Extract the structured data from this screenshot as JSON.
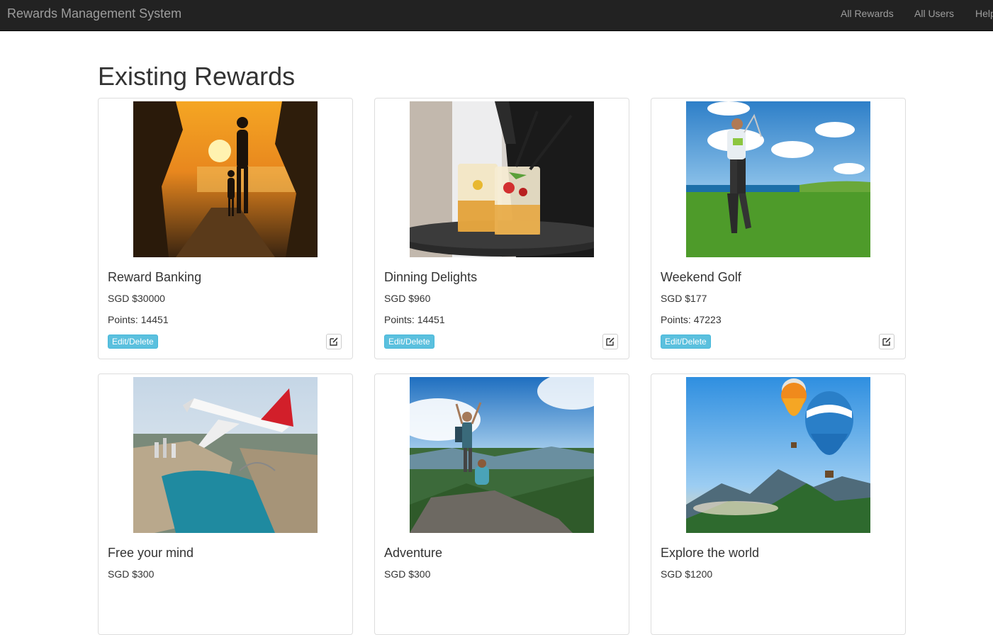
{
  "navbar": {
    "brand": "Rewards Management System",
    "links": [
      "All Rewards",
      "All Users",
      "Help"
    ]
  },
  "page": {
    "title": "Existing Rewards"
  },
  "rewards": [
    {
      "name": "Reward Banking",
      "price": "SGD $30000",
      "points": "Points: 14451",
      "edit_label": "Edit/Delete",
      "image": "sunset-family-photo",
      "show_actions": true
    },
    {
      "name": "Dinning Delights",
      "price": "SGD $960",
      "points": "Points: 14451",
      "edit_label": "Edit/Delete",
      "image": "cocktail-tray-photo",
      "show_actions": true
    },
    {
      "name": "Weekend Golf",
      "price": "SGD $177",
      "points": "Points: 47223",
      "edit_label": "Edit/Delete",
      "image": "golfer-photo",
      "show_actions": true
    },
    {
      "name": "Free your mind",
      "price": "SGD $300",
      "image": "airplane-city-photo",
      "show_actions": false
    },
    {
      "name": "Adventure",
      "price": "SGD $300",
      "image": "hikers-summit-photo",
      "show_actions": false
    },
    {
      "name": "Explore the world",
      "price": "SGD $1200",
      "image": "hot-air-balloons-photo",
      "show_actions": false
    }
  ],
  "colors": {
    "navbar_bg": "#222222",
    "info_button": "#5bc0de",
    "text": "#333333"
  }
}
